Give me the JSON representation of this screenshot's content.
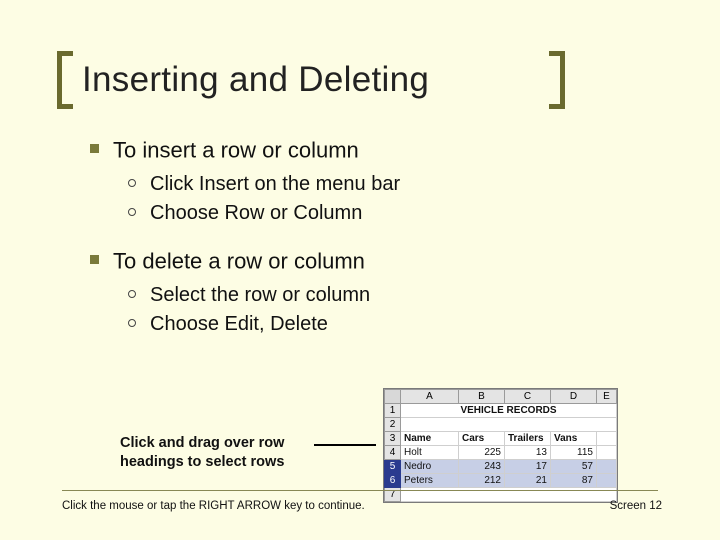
{
  "title": "Inserting and Deleting",
  "sections": [
    {
      "heading": "To insert a row or column",
      "items": [
        "Click Insert on the menu bar",
        "Choose Row or Column"
      ]
    },
    {
      "heading": "To delete a row or column",
      "items": [
        "Select the row or column",
        "Choose Edit, Delete"
      ]
    }
  ],
  "caption": "Click and drag over row headings to select rows",
  "sheet": {
    "col_letters": [
      "A",
      "B",
      "C",
      "D",
      "E"
    ],
    "sheet_title": "VEHICLE RECORDS",
    "headers": [
      "Name",
      "Cars",
      "Trailers",
      "Vans"
    ],
    "rows": [
      {
        "n": "Holt",
        "v": [
          "225",
          "13",
          "115"
        ],
        "sel": false
      },
      {
        "n": "Nedro",
        "v": [
          "243",
          "17",
          "57"
        ],
        "sel": true
      },
      {
        "n": "Peters",
        "v": [
          "212",
          "21",
          "87"
        ],
        "sel": true
      }
    ]
  },
  "footer": {
    "hint": "Click the mouse or tap the RIGHT ARROW key to continue.",
    "page": "Screen 12"
  }
}
